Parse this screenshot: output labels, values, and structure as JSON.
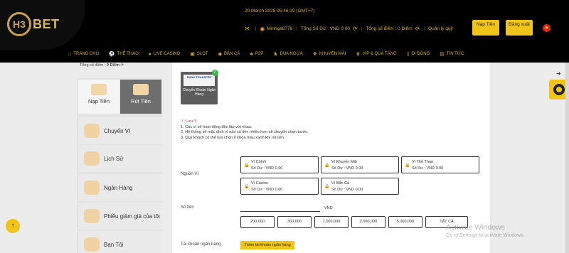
{
  "brand": {
    "logo_mark": "H3",
    "logo_text": "BET"
  },
  "header": {
    "datetime": "20 March 2025 05:46:19 (GMT+7)",
    "username": "Minhga8776",
    "balance_label": "Tổng Số Dư : VND 0.00",
    "points_label": "Tổng số điểm : 0 Điểm",
    "account_manage": "Quản lý quỹ",
    "deposit_btn": "Nạp Tiền",
    "logout_btn": "Đăng xuất",
    "language_flag": "vn-flag-icon"
  },
  "nav": [
    {
      "icon": "home-icon",
      "label": "TRANG CHỦ"
    },
    {
      "icon": "sports-icon",
      "label": "THỂ THAO"
    },
    {
      "icon": "casino-icon",
      "label": "LIVE CASINO"
    },
    {
      "icon": "slot-icon",
      "label": "SLOT"
    },
    {
      "icon": "fish-icon",
      "label": "BẮN CÁ"
    },
    {
      "icon": "p2p-icon",
      "label": "P2P"
    },
    {
      "icon": "horse-icon",
      "label": "ĐUA NGỰA"
    },
    {
      "icon": "gift-icon",
      "label": "KHUYẾN MÃI"
    },
    {
      "icon": "vip-icon",
      "label": "VIP & QUÀ TẶNG"
    },
    {
      "icon": "mobile-icon",
      "label": "DI ĐỘNG"
    },
    {
      "icon": "news-icon",
      "label": "TIN TỨC"
    }
  ],
  "sidebar": {
    "points_text": "Tổng số điểm :",
    "points_value": "0 Điểm",
    "tabs": [
      {
        "label": "Nạp Tiền",
        "active": false
      },
      {
        "label": "Rút Tiền",
        "active": true
      }
    ],
    "items": [
      {
        "label": "Chuyển Ví"
      },
      {
        "label": "Lịch Sử"
      },
      {
        "label": "Ngân Hàng"
      },
      {
        "label": "Phiếu giảm giá của tôi"
      },
      {
        "label": "Bạn Tôi"
      }
    ]
  },
  "main": {
    "method": {
      "logo_text": "BANK TRANSFER",
      "label": "Chuyển Khoản Ngân Hàng"
    },
    "notice": {
      "title": "Lưu Ý:",
      "lines": [
        "1. Các ví sẽ hoạt động độc lập với nhau.",
        "2. Hệ thống sẽ mặc định ví nào có tiền nhiều hơn sẽ chuyển chọn trước.",
        "3. Quý khách có thể lựa chọn ổ khóa màu xanh khi rút tiền."
      ]
    },
    "source_label": "Nguồn Ví:",
    "wallets": [
      {
        "name": "Ví Chính",
        "balance": "Số Dư : VND 0.00"
      },
      {
        "name": "Ví Khuyến Mãi",
        "balance": "Số Dư : VND 0.00"
      },
      {
        "name": "Ví Thể Thao",
        "balance": "Số Dư : VND 0.00"
      },
      {
        "name": "Ví Casino",
        "balance": "Số Dư : VND 0.00"
      },
      {
        "name": "Ví Bắn Cá",
        "balance": "Số Dư : VND 0.00"
      }
    ],
    "amount_label": "Số tiền",
    "currency": "VND",
    "amounts": [
      "200,000",
      "300,000",
      "1,000,000",
      "2,000,000",
      "5,000,000",
      "TẤT CẢ"
    ],
    "bank_account_label": "Tài khoản ngân hàng",
    "add_bank_btn": "Thêm tài khoản ngân hàng"
  },
  "watermark": {
    "line1": "Activate Windows",
    "line2": "Go to Settings to activate Windows."
  },
  "colors": {
    "gold": "#f0c419",
    "header_bg": "#000000",
    "text_gold": "#d4af37"
  }
}
